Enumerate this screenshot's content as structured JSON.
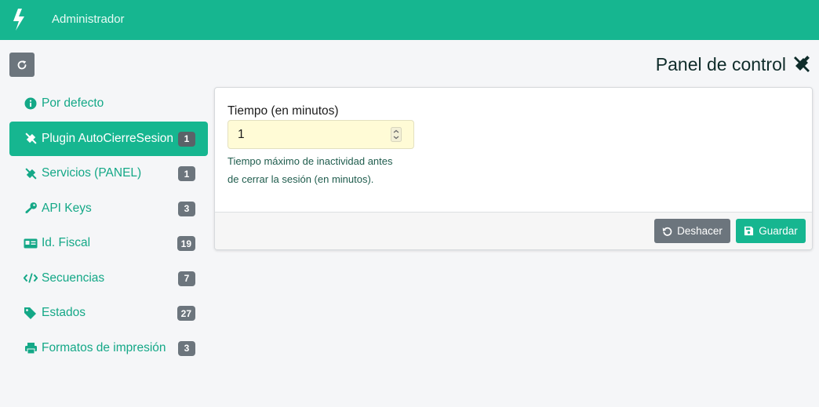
{
  "navbar": {
    "title": "Administrador",
    "brand_icon": "bolt-icon"
  },
  "page": {
    "title": "Panel de control",
    "title_icon": "tools-icon",
    "refresh_icon": "refresh-icon"
  },
  "sidebar": {
    "items": [
      {
        "label": "Por defecto",
        "badge": "",
        "icon": "info-circle-icon",
        "active": false
      },
      {
        "label": "Plugin AutoCierreSesion",
        "badge": "1",
        "icon": "tools-icon",
        "active": true
      },
      {
        "label": "Servicios (PANEL)",
        "badge": "1",
        "icon": "tools-icon",
        "active": false
      },
      {
        "label": "API Keys",
        "badge": "3",
        "icon": "key-icon",
        "active": false
      },
      {
        "label": "Id. Fiscal",
        "badge": "19",
        "icon": "id-card-icon",
        "active": false
      },
      {
        "label": "Secuencias",
        "badge": "7",
        "icon": "code-icon",
        "active": false
      },
      {
        "label": "Estados",
        "badge": "27",
        "icon": "tags-icon",
        "active": false
      },
      {
        "label": "Formatos de impresión",
        "badge": "3",
        "icon": "print-icon",
        "active": false
      }
    ]
  },
  "form": {
    "field_label": "Tiempo (en minutos)",
    "field_value": "1",
    "help_line1": "Tiempo máximo de inactividad antes",
    "help_line2": "de cerrar la sesión (en minutos)."
  },
  "footer": {
    "undo_label": "Deshacer",
    "save_label": "Guardar"
  },
  "colors": {
    "brand": "#16b690",
    "secondary": "#6c757d",
    "input_bg": "#fffbd6"
  }
}
